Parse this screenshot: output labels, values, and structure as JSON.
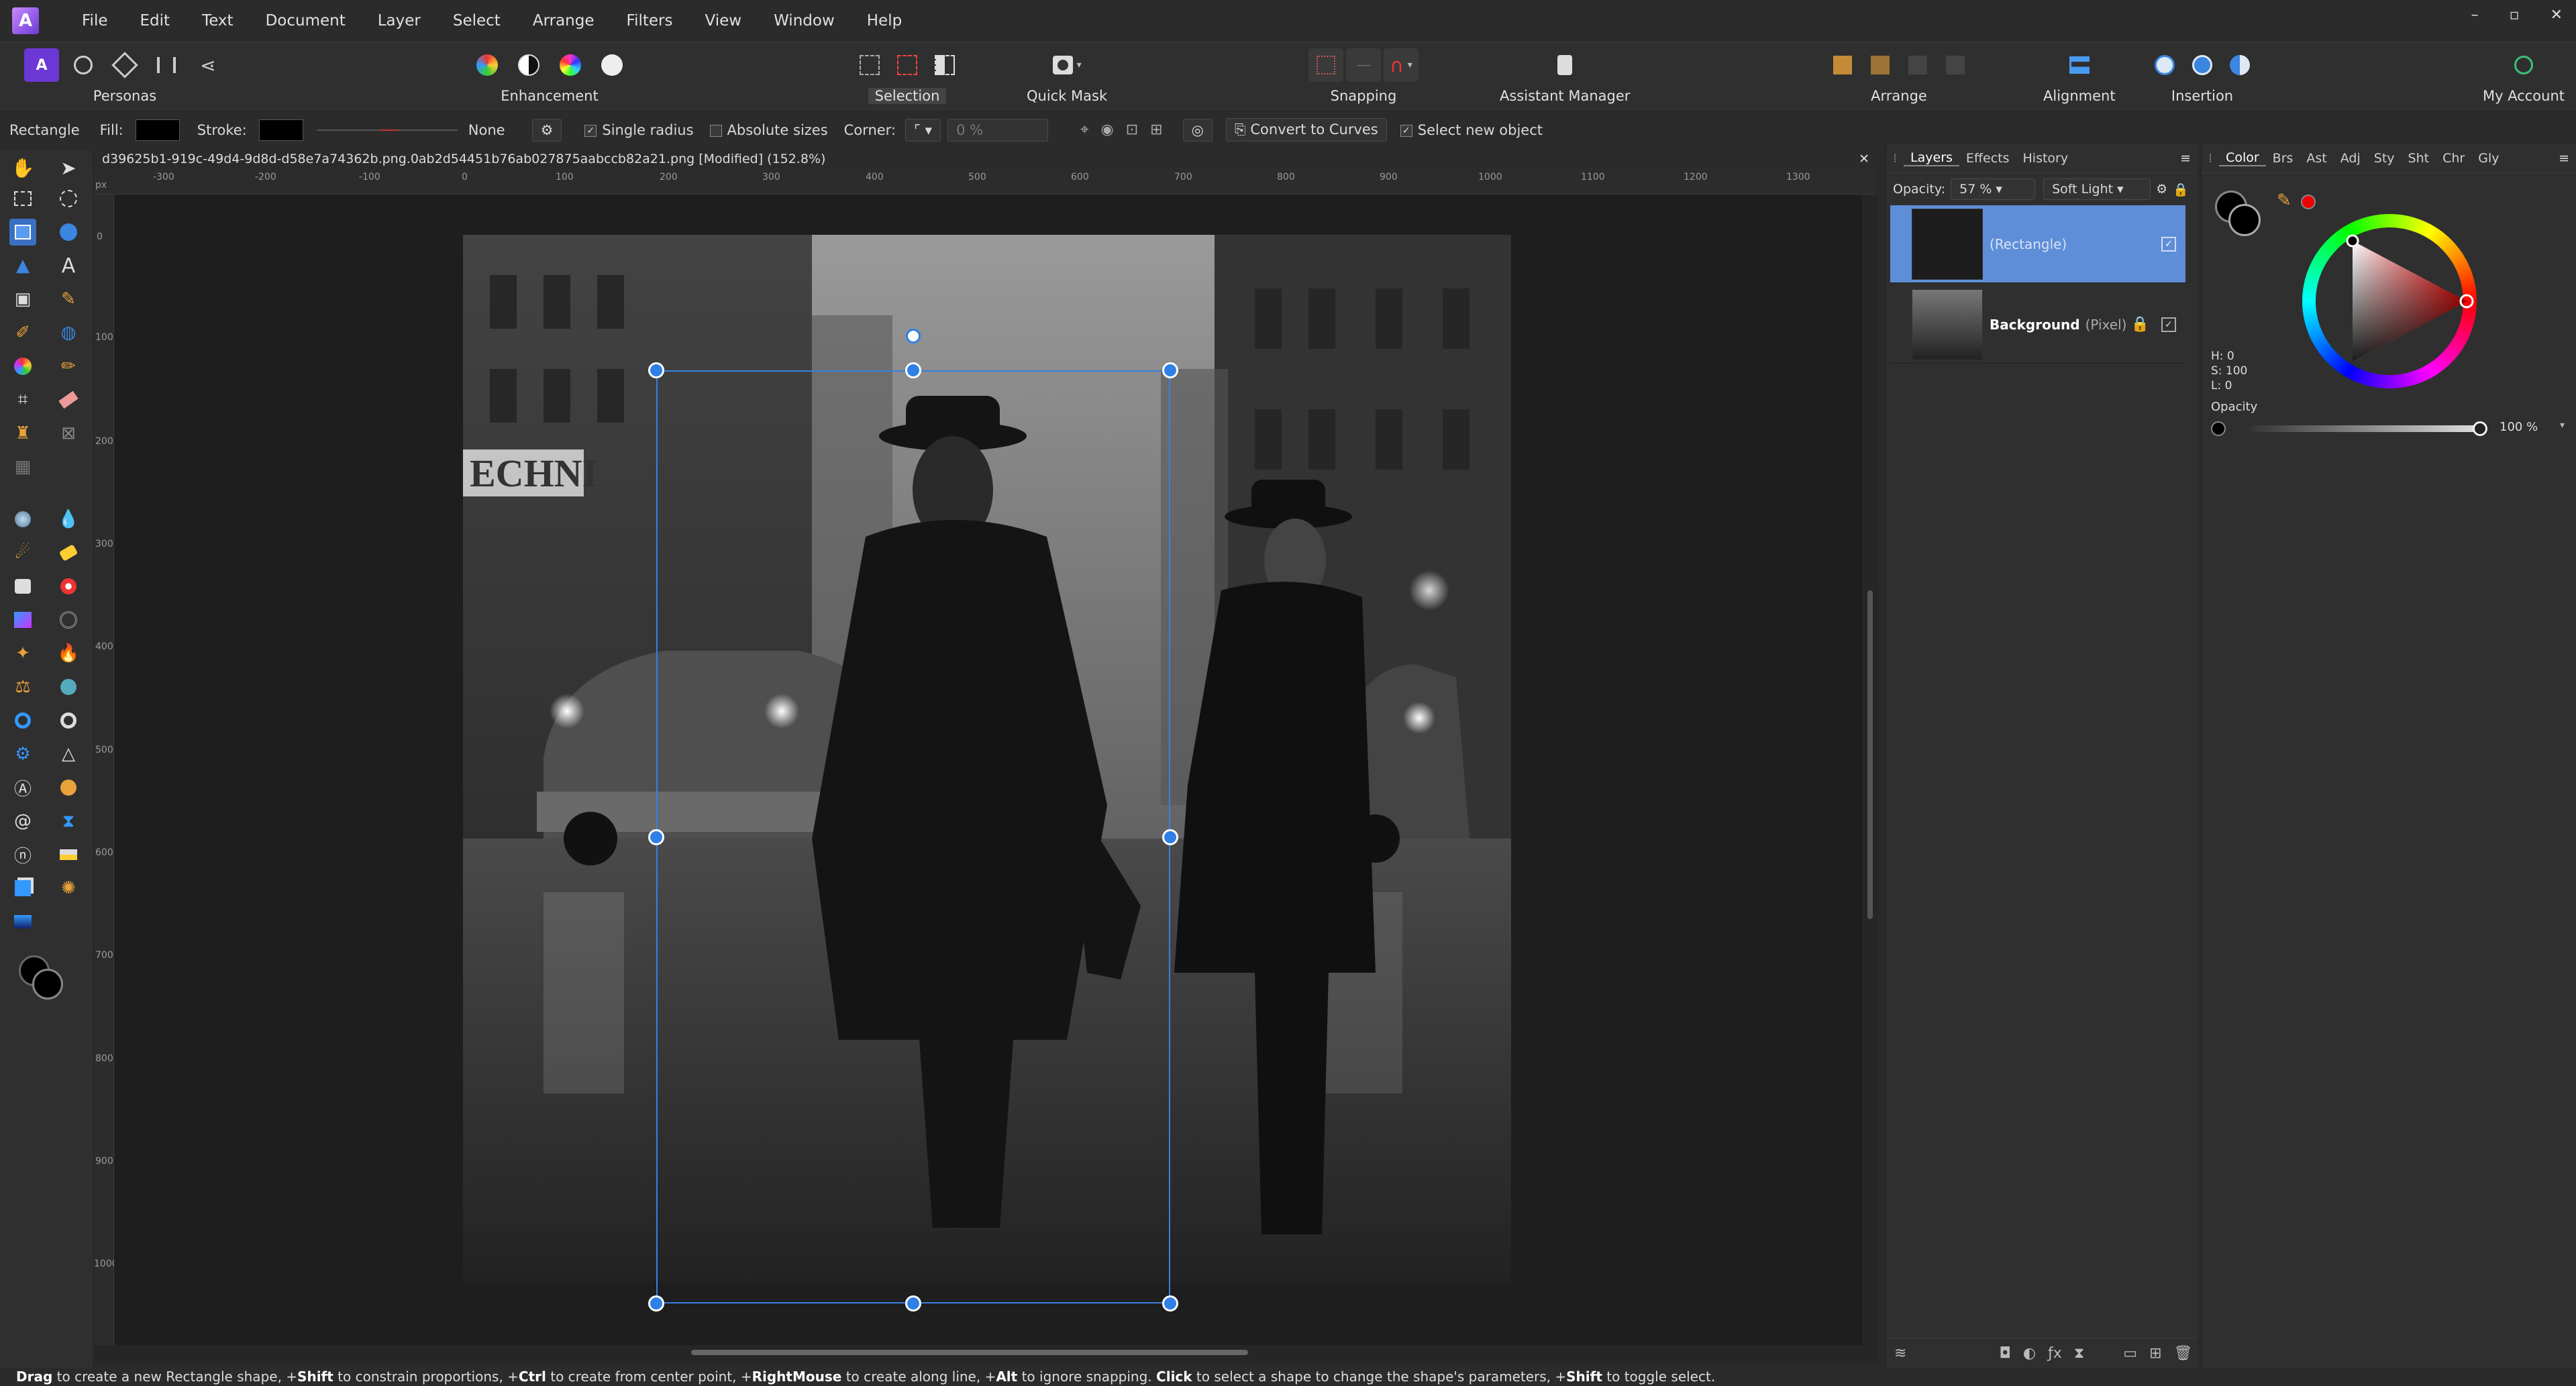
{
  "app": {
    "title": "Affinity Photo",
    "menu": [
      "File",
      "Edit",
      "Text",
      "Document",
      "Layer",
      "Select",
      "Arrange",
      "Filters",
      "View",
      "Window",
      "Help"
    ],
    "window_controls": [
      "–",
      "▫",
      "✕"
    ]
  },
  "toolbar": {
    "personas_label": "Personas",
    "enhancement_label": "Enhancement",
    "selection_label": "Selection",
    "quick_mask_label": "Quick Mask",
    "snapping_label": "Snapping",
    "assistant_label": "Assistant Manager",
    "arrange_label": "Arrange",
    "alignment_label": "Alignment",
    "insertion_label": "Insertion",
    "account_label": "My Account"
  },
  "context": {
    "tool_name": "Rectangle",
    "fill_label": "Fill:",
    "stroke_label": "Stroke:",
    "stroke_value": "None",
    "single_radius": "Single radius",
    "absolute_sizes": "Absolute sizes",
    "corner_label": "Corner:",
    "corner_value": "0 %",
    "convert_label": "Convert to Curves",
    "select_new_label": "Select new object"
  },
  "document": {
    "tab_title": "d39625b1-919c-49d4-9d8d-d58e7a74362b.png.0ab2d54451b76ab027875aabccb82a21.png [Modified] (152.8%)",
    "ruler_unit": "px",
    "ruler_top": [
      "-300",
      "-200",
      "-100",
      "0",
      "100",
      "200",
      "300",
      "400",
      "500",
      "600",
      "700",
      "800",
      "900",
      "1000",
      "1100",
      "1200",
      "1300"
    ],
    "ruler_left": [
      "0",
      "100",
      "200",
      "300",
      "400",
      "500",
      "600",
      "700",
      "800",
      "900",
      "1000"
    ]
  },
  "layers_panel": {
    "tabs": [
      "Layers",
      "Effects",
      "History"
    ],
    "opacity_label": "Opacity:",
    "opacity_value": "57 %",
    "blend_mode": "Soft Light",
    "layers": [
      {
        "name": "(Rectangle)",
        "type": ""
      },
      {
        "name": "Background",
        "type": "(Pixel)"
      }
    ]
  },
  "color_panel": {
    "tabs": [
      "Color",
      "Brs",
      "Ast",
      "Adj",
      "Sty",
      "Sht",
      "Chr",
      "Gly"
    ],
    "h": "H: 0",
    "s": "S: 100",
    "l": "L: 0",
    "opacity_label": "Opacity",
    "opacity_value": "100 %",
    "accent_color": "#ff0000"
  },
  "status": {
    "segments": [
      {
        "b": "Drag",
        "t": " to create a new Rectangle shape, +"
      },
      {
        "b": "Shift",
        "t": " to constrain proportions, +"
      },
      {
        "b": "Ctrl",
        "t": " to create from center point, +"
      },
      {
        "b": "RightMouse",
        "t": " to create along line, +"
      },
      {
        "b": "Alt",
        "t": " to ignore snapping. "
      },
      {
        "b": "Click",
        "t": " to select a shape to change the shape's parameters, +"
      },
      {
        "b": "Shift",
        "t": " to toggle select."
      }
    ]
  }
}
